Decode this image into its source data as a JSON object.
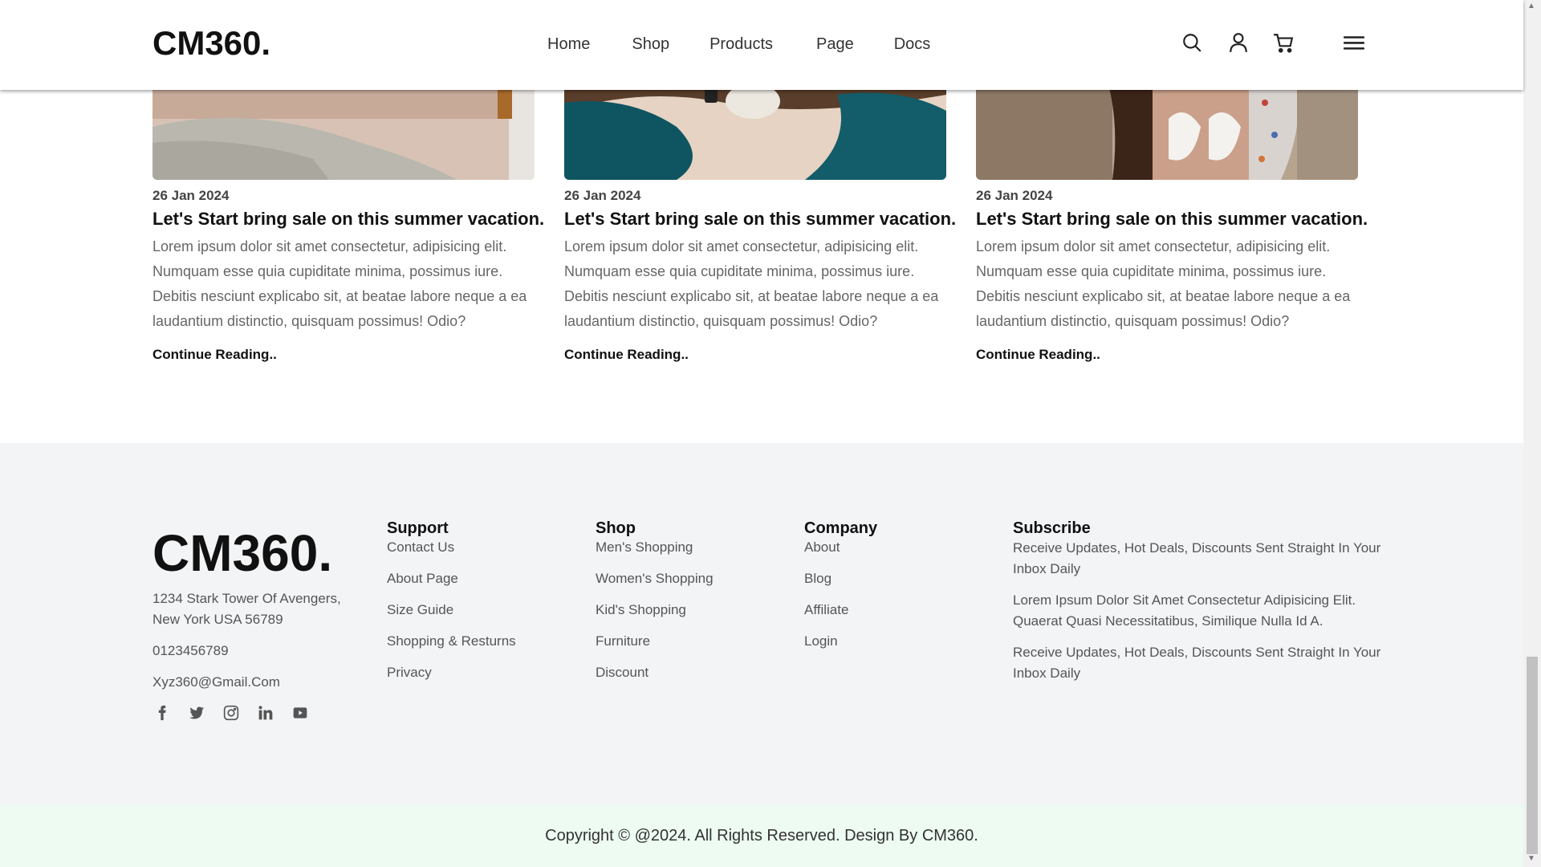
{
  "header": {
    "logo": "CM360.",
    "nav": [
      "Home",
      "Shop",
      "Products",
      "Page",
      "Docs"
    ],
    "icons": [
      "search-icon",
      "user-icon",
      "cart-icon",
      "menu-icon"
    ]
  },
  "posts": [
    {
      "date": "26 Jan 2024",
      "title": "Let's Start bring sale on this summer vacation.",
      "excerpt": "Lorem ipsum dolor sit amet consectetur, adipisicing elit. Numquam esse quia cupiditate minima, possimus iure. Debitis nesciunt explicabo sit, at beatae labore neque a ea laudantium distinctio, quisquam possimus! Odio?",
      "link": "Continue Reading.."
    },
    {
      "date": "26 Jan 2024",
      "title": "Let's Start bring sale on this summer vacation.",
      "excerpt": "Lorem ipsum dolor sit amet consectetur, adipisicing elit. Numquam esse quia cupiditate minima, possimus iure. Debitis nesciunt explicabo sit, at beatae labore neque a ea laudantium distinctio, quisquam possimus! Odio?",
      "link": "Continue Reading.."
    },
    {
      "date": "26 Jan 2024",
      "title": "Let's Start bring sale on this summer vacation.",
      "excerpt": "Lorem ipsum dolor sit amet consectetur, adipisicing elit. Numquam esse quia cupiditate minima, possimus iure. Debitis nesciunt explicabo sit, at beatae labore neque a ea laudantium distinctio, quisquam possimus! Odio?",
      "link": "Continue Reading.."
    }
  ],
  "footer": {
    "logo": "CM360.",
    "address_line1": "1234 Stark Tower Of Avengers,",
    "address_line2": "New York USA 56789",
    "phone": "0123456789",
    "email": "Xyz360@Gmail.Com",
    "social": [
      "facebook-icon",
      "twitter-icon",
      "instagram-icon",
      "linkedin-icon",
      "youtube-icon"
    ],
    "support": {
      "title": "Support",
      "items": [
        "Contact Us",
        "About Page",
        "Size Guide",
        "Shopping & Resturns",
        "Privacy"
      ]
    },
    "shop": {
      "title": "Shop",
      "items": [
        "Men's Shopping",
        "Women's Shopping",
        "Kid's Shopping",
        "Furniture",
        "Discount"
      ]
    },
    "company": {
      "title": "Company",
      "items": [
        "About",
        "Blog",
        "Affiliate",
        "Login"
      ]
    },
    "subscribe": {
      "title": "Subscribe",
      "p1": "Receive Updates, Hot Deals, Discounts Sent Straight In Your Inbox Daily",
      "p2": "Lorem Ipsum Dolor Sit Amet Consectetur Adipisicing Elit. Quaerat Quasi Necessitatibus, Similique Nulla Id A.",
      "p3": "Receive Updates, Hot Deals, Discounts Sent Straight In Your Inbox Daily"
    }
  },
  "copyright": "Copyright © @2024. All Rights Reserved. Design By CM360.",
  "colors": {
    "footer_bg": "#f3f4f6",
    "copyright_bg": "#edfbf2",
    "text_dark": "#111111",
    "text_muted": "#666666"
  }
}
